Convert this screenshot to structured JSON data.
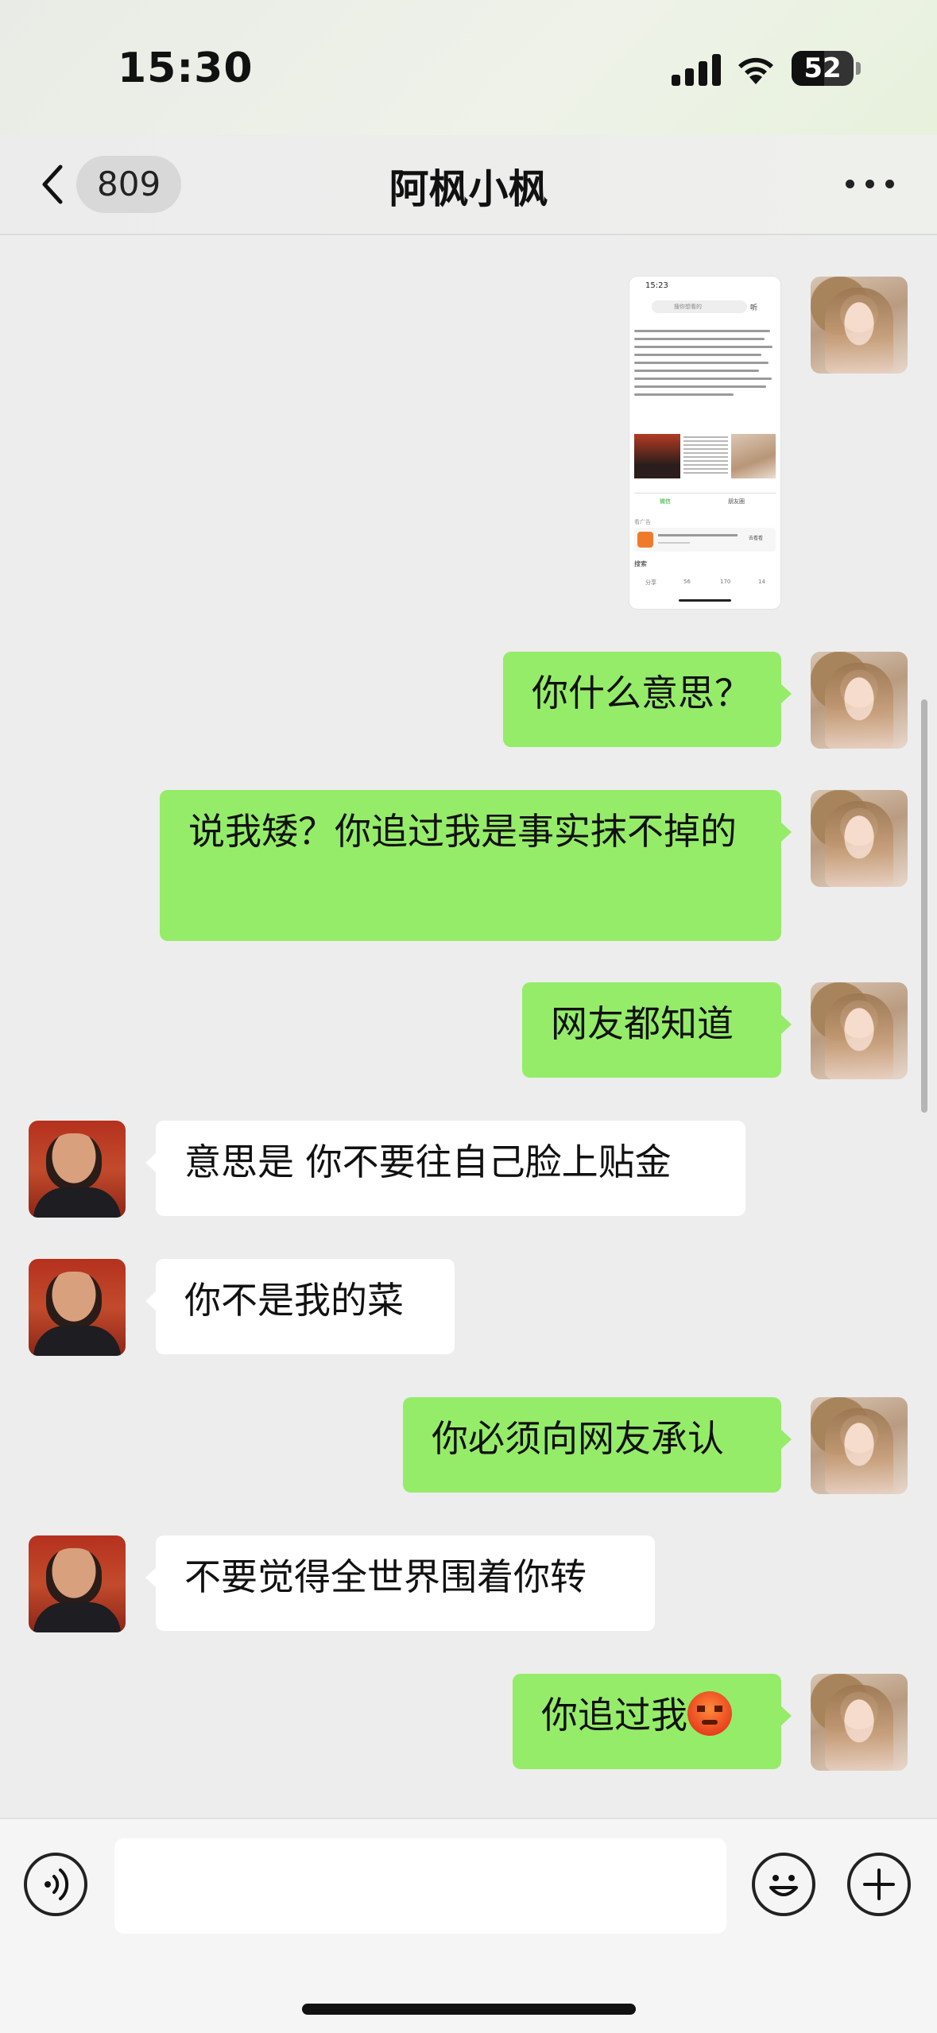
{
  "status_bar": {
    "time": "15:30",
    "battery_level": "52",
    "icons": [
      "signal-icon",
      "wifi-icon",
      "battery-icon"
    ]
  },
  "nav": {
    "unread_count": "809",
    "title": "阿枫小枫",
    "back_icon": "chevron-left-icon",
    "more_icon": "more-dots-icon"
  },
  "image_message": {
    "time": "15:23",
    "search_placeholder": "搜你想看的",
    "listen": "听",
    "wechat": "微信",
    "share": "朋友圈",
    "ad_title": "看广告",
    "ad_button": "去看看",
    "search_label": "搜索",
    "actions": [
      "分享",
      "56",
      "170",
      "14"
    ]
  },
  "messages": [
    {
      "sender": "me",
      "type": "image"
    },
    {
      "sender": "me",
      "text": "你什么意思？"
    },
    {
      "sender": "me",
      "text": "说我矮？你追过我是事实抹不掉的"
    },
    {
      "sender": "me",
      "text": "网友都知道"
    },
    {
      "sender": "friend",
      "text": "意思是 你不要往自己脸上贴金"
    },
    {
      "sender": "friend",
      "text": "你不是我的菜"
    },
    {
      "sender": "me",
      "text": "你必须向网友承认"
    },
    {
      "sender": "friend",
      "text": "不要觉得全世界围着你转"
    },
    {
      "sender": "me",
      "text": "你追过我",
      "emoji": "angry-face-emoji"
    }
  ],
  "input_bar": {
    "placeholder": "",
    "icons": [
      "voice-icon",
      "emoji-icon",
      "plus-icon"
    ]
  },
  "colors": {
    "my_bubble": "#95ec69",
    "friend_bubble": "#ffffff",
    "chat_background": "#ededed"
  }
}
